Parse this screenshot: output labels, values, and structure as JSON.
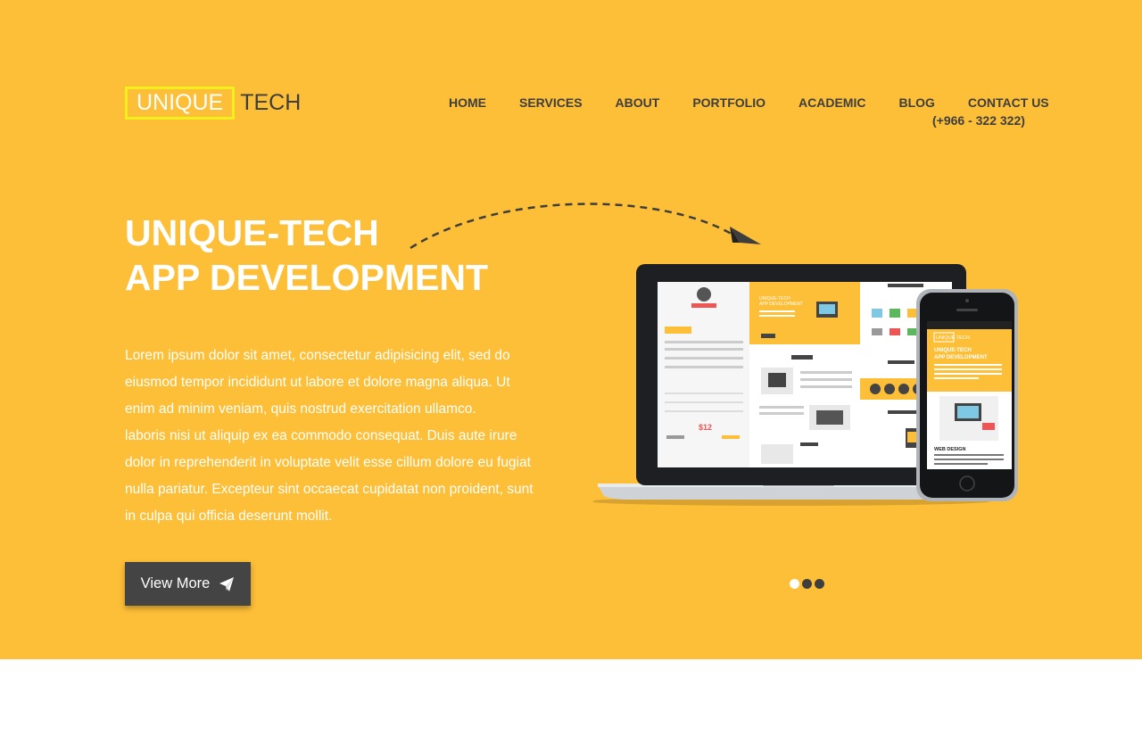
{
  "brand": {
    "primary": "UNIQUE",
    "secondary": "TECH"
  },
  "nav": {
    "items": [
      {
        "label": "HOME"
      },
      {
        "label": "SERVICES"
      },
      {
        "label": "ABOUT"
      },
      {
        "label": "PORTFOLIO"
      },
      {
        "label": "ACADEMIC"
      },
      {
        "label": "BLOG"
      },
      {
        "label": "CONTACT US"
      }
    ],
    "phone": "(+966 - 322 322)"
  },
  "hero": {
    "headline": [
      "UNIQUE-TECH",
      "APP DEVELOPMENT"
    ],
    "body_lines": [
      "Lorem ipsum dolor sit amet, consectetur adipisicing elit, sed do",
      "eiusmod tempor incididunt ut labore et dolore magna aliqua. Ut",
      "enim ad minim veniam, quis nostrud exercitation ullamco.",
      "laboris nisi ut aliquip ex ea commodo consequat. Duis aute irure",
      "dolor in reprehenderit in voluptate velit esse cillum dolore eu fugiat",
      "nulla pariatur. Excepteur sint occaecat cupidatat non proident, sunt",
      "in culpa qui officia deserunt mollit."
    ],
    "button_label": "View More"
  },
  "mockup": {
    "laptop_headline": [
      "UNIQUE-TECH",
      "APP DEVELOPMENT"
    ],
    "price": "$12",
    "phone_brand": "UNIQUE TECH",
    "phone_headline": [
      "UNIQUE-TECH",
      "APP DEVELOPMENT"
    ],
    "phone_section": "WEB DESIGN"
  },
  "carousel": {
    "slide_count": 3,
    "active_index": 0
  },
  "colors": {
    "hero_bg": "#fdbf38",
    "dark": "#3e3e3e",
    "button": "#444444",
    "logo_border": "#f2ef1a"
  }
}
